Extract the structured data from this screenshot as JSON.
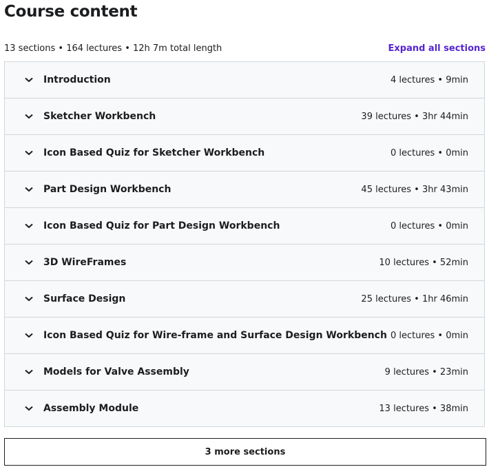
{
  "header": {
    "title": "Course content",
    "summary": "13 sections • 164 lectures • 12h 7m total length",
    "expand_label": "Expand all sections"
  },
  "sections": [
    {
      "title": "Introduction",
      "meta": "4 lectures • 9min"
    },
    {
      "title": "Sketcher Workbench",
      "meta": "39 lectures • 3hr 44min"
    },
    {
      "title": "Icon Based Quiz for Sketcher Workbench",
      "meta": "0 lectures • 0min"
    },
    {
      "title": "Part Design Workbench",
      "meta": "45 lectures • 3hr 43min"
    },
    {
      "title": "Icon Based Quiz for Part Design Workbench",
      "meta": "0 lectures • 0min"
    },
    {
      "title": "3D WireFrames",
      "meta": "10 lectures • 52min"
    },
    {
      "title": "Surface Design",
      "meta": "25 lectures • 1hr 46min"
    },
    {
      "title": "Icon Based Quiz for Wire-frame and Surface Design Workbench",
      "meta": "0 lectures • 0min"
    },
    {
      "title": "Models for Valve Assembly",
      "meta": "9 lectures • 23min"
    },
    {
      "title": "Assembly Module",
      "meta": "13 lectures • 38min"
    }
  ],
  "more_button": {
    "label": "3 more sections"
  },
  "icons": {
    "section_toggle": "chevron-down-icon"
  },
  "colors": {
    "accent": "#5624d0",
    "section_bg": "#f7f9fa",
    "border": "#d1d7dc",
    "text": "#1c1d1f"
  }
}
